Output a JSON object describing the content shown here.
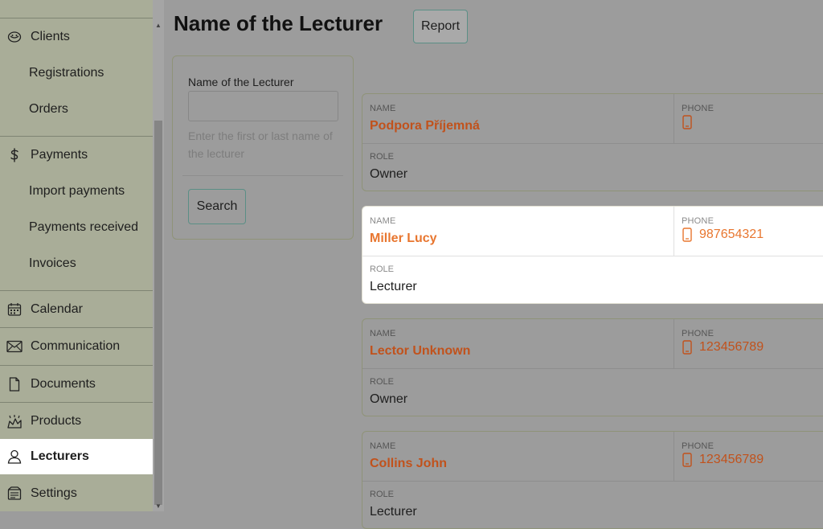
{
  "sidebar": {
    "items": [
      {
        "label": "Clients",
        "icon": "clients-icon"
      },
      {
        "label": "Registrations"
      },
      {
        "label": "Orders"
      },
      {
        "label": "Payments",
        "icon": "money-icon"
      },
      {
        "label": "Import payments"
      },
      {
        "label": "Payments received"
      },
      {
        "label": "Invoices"
      },
      {
        "label": "Calendar",
        "icon": "calendar-icon"
      },
      {
        "label": "Communication",
        "icon": "envelope-icon"
      },
      {
        "label": "Documents",
        "icon": "document-icon"
      },
      {
        "label": "Products",
        "icon": "products-icon"
      },
      {
        "label": "Lecturers",
        "icon": "user-icon",
        "active": true
      },
      {
        "label": "Settings",
        "icon": "settings-icon"
      }
    ]
  },
  "header": {
    "title": "Name of the Lecturer",
    "report_label": "Report"
  },
  "search": {
    "label": "Name of the Lecturer",
    "value": "",
    "hint": "Enter the first or last name of the lecturer",
    "button_label": "Search"
  },
  "table": {
    "name_header": "NAME",
    "phone_header": "PHONE",
    "role_header": "ROLE",
    "rows": [
      {
        "name": "Podpora Příjemná",
        "phone": "",
        "role": "Owner"
      },
      {
        "name": "Miller Lucy",
        "phone": "987654321",
        "role": "Lecturer",
        "highlighted": true
      },
      {
        "name": "Lector Unknown",
        "phone": "123456789",
        "role": "Owner"
      },
      {
        "name": "Collins John",
        "phone": "123456789",
        "role": "Lecturer"
      }
    ]
  },
  "colors": {
    "accent_orange": "#e8762f",
    "sidebar_bg": "#a9ad98",
    "button_border": "#5b8f86"
  }
}
